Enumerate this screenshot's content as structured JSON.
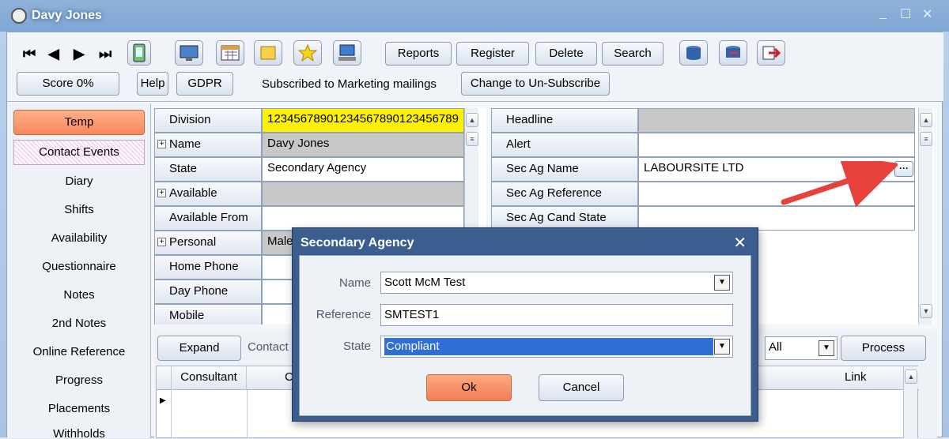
{
  "window": {
    "title": "Davy Jones",
    "controls": [
      "_",
      "☐",
      "✕"
    ]
  },
  "toolbar": {
    "nav": [
      "⏮",
      "◀",
      "▶",
      "⏭"
    ],
    "reports": "Reports",
    "register": "Register",
    "delete": "Delete",
    "search": "Search",
    "score": "Score 0%",
    "help": "Help",
    "gdpr": "GDPR",
    "marketing_status": "Subscribed to Marketing mailings",
    "unsubscribe": "Change to Un-Subscribe",
    "icons": [
      "mobile-icon",
      "monitor-icon",
      "calendar-icon",
      "note-icon",
      "star-icon",
      "computer-icon",
      "db-icon-1",
      "db-icon-2",
      "exit-icon"
    ]
  },
  "sidebar": {
    "items": [
      "Temp",
      "Contact Events",
      "Diary",
      "Shifts",
      "Availability",
      "Questionnaire",
      "Notes",
      "2nd Notes",
      "Online Reference",
      "Progress",
      "Placements",
      "Withholds"
    ]
  },
  "left_grid": {
    "rows": [
      {
        "label": "Division",
        "value": "12345678901234567890123456789",
        "bg": "#fff200"
      },
      {
        "label": "Name",
        "value": "Davy Jones",
        "bg": "#c8c8c8",
        "expand": "+"
      },
      {
        "label": "State",
        "value": "Secondary Agency",
        "bg": "#ffffff"
      },
      {
        "label": "Available",
        "value": "",
        "bg": "#c8c8c8",
        "expand": "+"
      },
      {
        "label": "Available From",
        "value": "",
        "bg": "#ffffff"
      },
      {
        "label": "Personal",
        "value": "Male",
        "bg": "#c8c8c8",
        "expand": "+"
      },
      {
        "label": "Home Phone",
        "value": "",
        "bg": "#ffffff"
      },
      {
        "label": "Day Phone",
        "value": "",
        "bg": "#ffffff"
      },
      {
        "label": "Mobile",
        "value": "",
        "bg": "#ffffff"
      }
    ]
  },
  "right_grid": {
    "rows": [
      {
        "label": "Headline",
        "value": "",
        "bg": "#c8c8c8"
      },
      {
        "label": "Alert",
        "value": "",
        "bg": "#ffffff"
      },
      {
        "label": "Sec Ag Name",
        "value": "LABOURSITE LTD",
        "bg": "#ffffff"
      },
      {
        "label": "Sec Ag Reference",
        "value": "",
        "bg": "#ffffff"
      },
      {
        "label": "Sec Ag Cand State",
        "value": "",
        "bg": "#ffffff"
      }
    ],
    "ellipsis": "···"
  },
  "events": {
    "expand": "Expand",
    "contact_label": "Contact",
    "filter_value": "All",
    "process": "Process",
    "columns": [
      "Consultant",
      "C",
      "Link"
    ]
  },
  "dialog": {
    "title": "Secondary Agency",
    "close": "✕",
    "name_label": "Name",
    "name_value": "Scott McM Test",
    "reference_label": "Reference",
    "reference_value": "SMTEST1",
    "state_label": "State",
    "state_value": "Compliant",
    "ok": "Ok",
    "cancel": "Cancel"
  }
}
